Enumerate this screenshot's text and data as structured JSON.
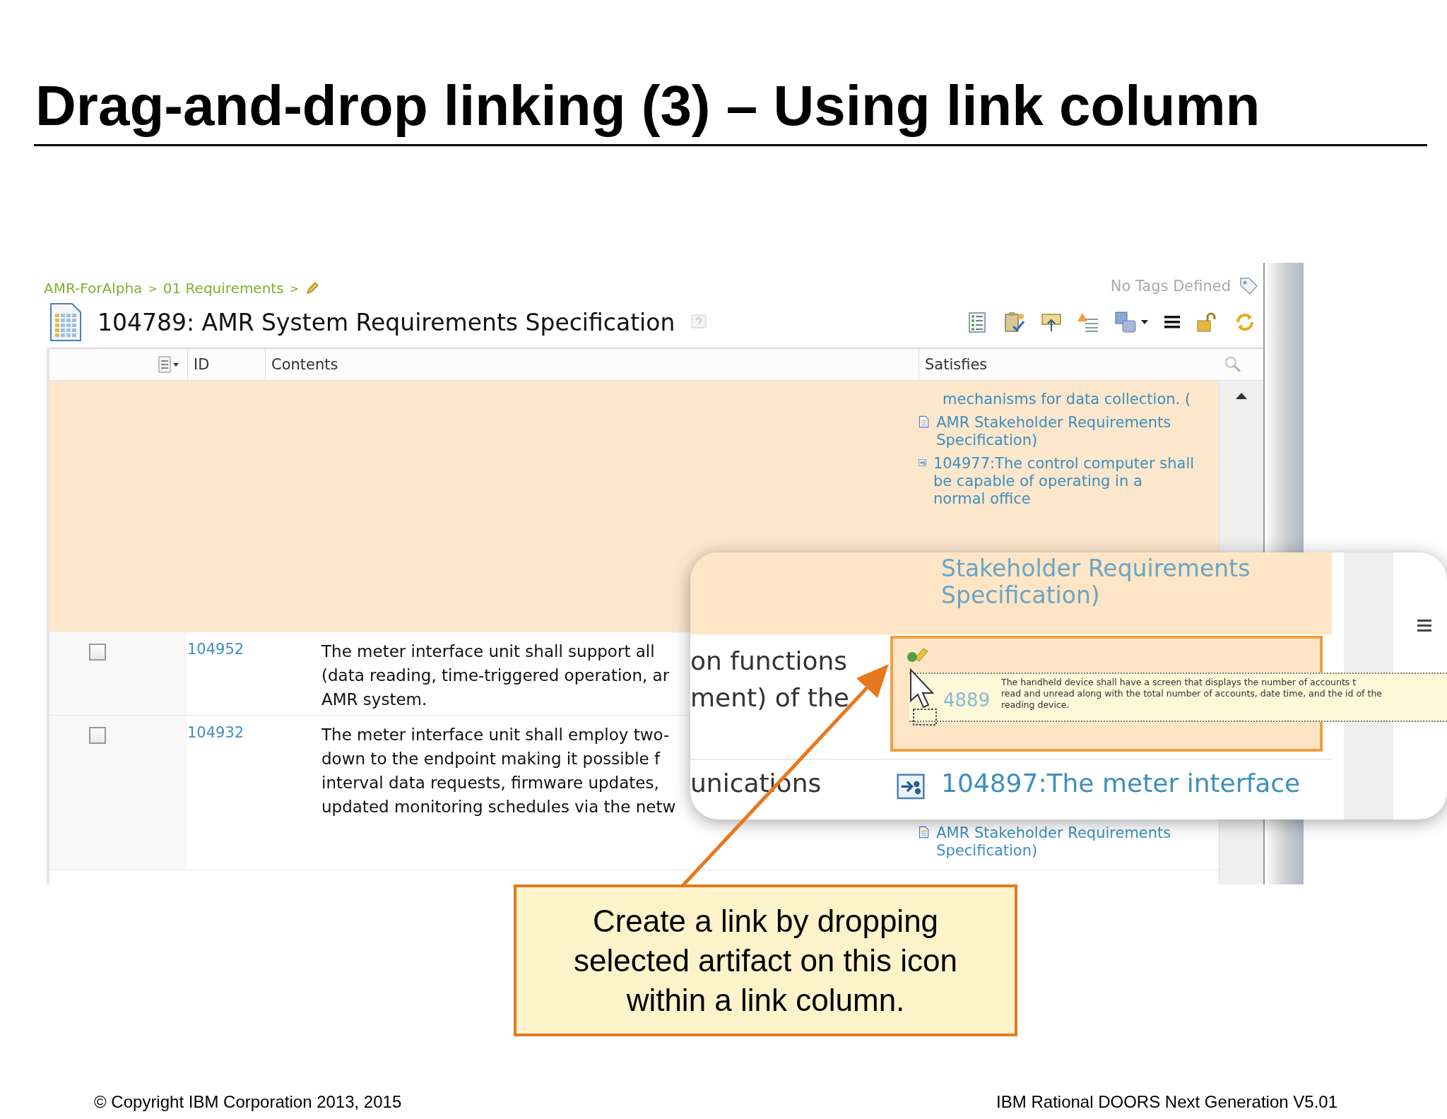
{
  "slide": {
    "title": "Drag-and-drop linking (3) – Using link column",
    "footer_left": "© Copyright IBM Corporation 2013, 2015",
    "footer_right": "IBM Rational DOORS Next Generation V5.01"
  },
  "app": {
    "breadcrumb": [
      {
        "label": "AMR-ForAlpha",
        "separator": ">"
      },
      {
        "label": "01 Requirements",
        "separator": ">"
      }
    ],
    "tags": "No Tags Defined",
    "title": "104789: AMR System Requirements Specification",
    "columns": {
      "id": "ID",
      "contents": "Contents",
      "satisfies": "Satisfies"
    },
    "drop_row": {
      "satisfies": [
        {
          "kind": "module_ref",
          "before": "mechanisms for data collection. (",
          "module": "AMR Stakeholder Requirements Specification)"
        },
        {
          "kind": "link",
          "text": "104977:The control computer shall be capable of operating in a normal office"
        }
      ]
    },
    "rows": [
      {
        "id": "104952",
        "checked": false,
        "selected": false,
        "contents": [
          "The meter interface unit shall support all",
          "(data reading, time-triggered operation, ar",
          "AMR system."
        ],
        "satisfies": []
      },
      {
        "id": "104932",
        "checked": false,
        "selected": false,
        "contents": [
          "The meter interface unit shall employ two-",
          "down to the endpoint making it possible f",
          "interval data requests, firmware updates,",
          "updated monitoring schedules via the netw"
        ],
        "satisfies": [
          {
            "kind": "module",
            "text": "AMR Stakeholder Requirements Specification)"
          }
        ]
      }
    ]
  },
  "magnifier": {
    "top_text": "Stakeholder Requirements Specification)",
    "left_lines": [
      "on functions",
      "ment) of the"
    ],
    "left_lower": "unications",
    "target_id": "4889",
    "tooltip": [
      "The handheld device shall have a screen that displays the number of accounts t",
      "read and unread along with the total number of accounts, date time, and the id of the",
      "reading device."
    ],
    "link": "104897:The meter interface"
  },
  "callout": [
    "Create a link by dropping",
    "selected artifact on this icon",
    "within a link column."
  ]
}
